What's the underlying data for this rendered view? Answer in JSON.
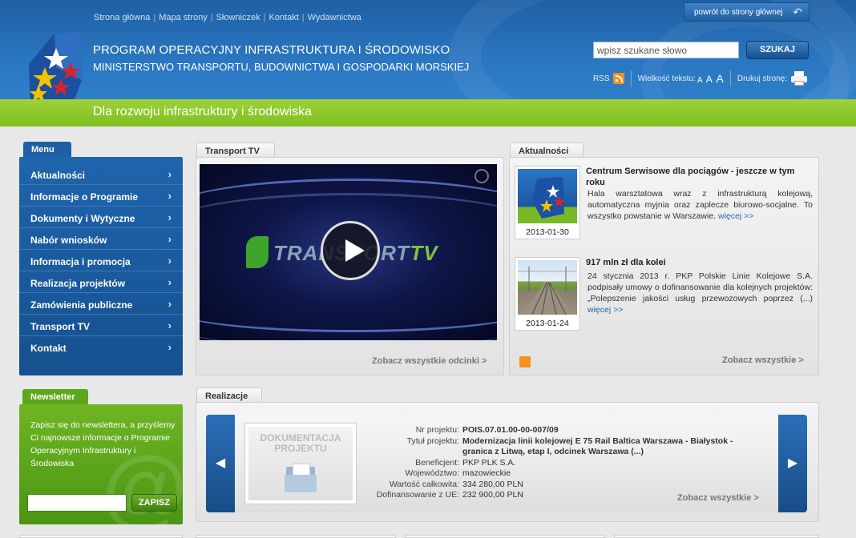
{
  "topnav": {
    "links": [
      "Strona główna",
      "Mapa strony",
      "Słowniczek",
      "Kontakt",
      "Wydawnictwa"
    ]
  },
  "header": {
    "program_title": "PROGRAM OPERACYJNY INFRASTRUKTURA I ŚRODOWISKO",
    "ministry": "MINISTERSTWO TRANSPORTU, BUDOWNICTWA I GOSPODARKI MORSKIEJ",
    "home_button": "powrót do strony głównej",
    "search_placeholder": "wpisz szukane słowo",
    "search_button": "SZUKAJ",
    "rss_label": "RSS",
    "font_size_label": "Wielkość tekstu:",
    "font_sizes": [
      "A",
      "A",
      "A"
    ],
    "print_label": "Drukuj stronę:",
    "slogan": "Dla rozwoju infrastruktury i środowiska"
  },
  "menu": {
    "tab_label": "Menu",
    "items": [
      {
        "label": "Aktualności"
      },
      {
        "label": "Informacje o Programie"
      },
      {
        "label": "Dokumenty i Wytyczne"
      },
      {
        "label": "Nabór wniosków"
      },
      {
        "label": "Informacja i promocja"
      },
      {
        "label": "Realizacja projektów"
      },
      {
        "label": "Zamówienia publiczne"
      },
      {
        "label": "Transport TV"
      },
      {
        "label": "Kontakt"
      }
    ]
  },
  "newsletter": {
    "tab_label": "Newsletter",
    "text": "Zapisz się do newslettera, a przyślemy Ci najnowsze informacje o Programie Operacyjnym Infrastruktury i Środowiska",
    "button": "ZAPISZ"
  },
  "transport_tv": {
    "tab_label": "Transport TV",
    "video_logo_main": "TRANSPORT",
    "video_logo_tv": "TV",
    "see_all": "Zobacz wszystkie odcinki >"
  },
  "aktualnosci": {
    "tab_label": "Aktualności",
    "items": [
      {
        "title": "Centrum Serwisowe dla pociągów - jeszcze w tym roku",
        "body": "Hala warsztatowa wraz z infrastrukturą kolejową, automatyczna myjnia oraz zaplecze biurowo-socjalne. To wszystko powstanie w Warszawie.",
        "more": "więcej >>",
        "date": "2013-01-30"
      },
      {
        "title": "917 mln zł dla kolei",
        "body": "24 stycznia 2013 r. PKP Polskie Linie Kolejowe S.A. podpisały umowy o dofinansowanie dla kolejnych projektów: „Polepszenie jakości usług przewozowych poprzez (...)",
        "more": "więcej >>",
        "date": "2013-01-24"
      }
    ],
    "see_all": "Zobacz wszystkie >"
  },
  "realizacje": {
    "tab_label": "Realizacje",
    "doc_label_line1": "DOKUMENTACJA",
    "doc_label_line2": "PROJEKTU",
    "rows": [
      {
        "label": "Nr projektu:",
        "value": "POIS.07.01.00-00-007/09"
      },
      {
        "label": "Tytuł projektu:",
        "value": "Modernizacja linii kolejowej E 75 Rail Baltica Warszawa - Białystok - granica z Litwą, etap I, odcinek Warszawa (...)"
      },
      {
        "label": "Beneficjent:",
        "value": "PKP PLK S.A."
      },
      {
        "label": "Województwo:",
        "value": "mazowieckie"
      },
      {
        "label": "Wartość całkowita:",
        "value": "334 280,00 PLN"
      },
      {
        "label": "Dofinansowanie z UE:",
        "value": "232 900,00 PLN"
      }
    ],
    "see_all": "Zobacz wszystkie >"
  },
  "colors": {
    "header_blue": "#2a76c0",
    "green_bar": "#8cc72a",
    "menu_blue": "#1e5fa5",
    "newsletter_green": "#5ea71a",
    "link_blue": "#1f64ad"
  }
}
